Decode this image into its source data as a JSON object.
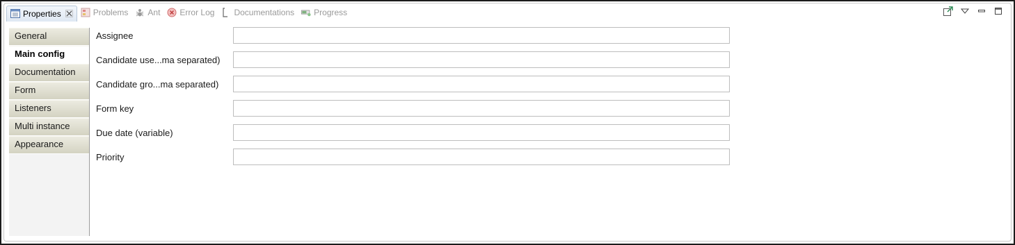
{
  "tabs": [
    {
      "label": "Properties",
      "icon": "properties-icon",
      "active": true
    },
    {
      "label": "Problems",
      "icon": "problems-icon"
    },
    {
      "label": "Ant",
      "icon": "ant-icon"
    },
    {
      "label": "Error Log",
      "icon": "error-log-icon"
    },
    {
      "label": "Documentations",
      "icon": "documentations-icon"
    },
    {
      "label": "Progress",
      "icon": "progress-icon"
    }
  ],
  "sidebar": {
    "items": [
      {
        "label": "General"
      },
      {
        "label": "Main config",
        "selected": true
      },
      {
        "label": "Documentation"
      },
      {
        "label": "Form"
      },
      {
        "label": "Listeners"
      },
      {
        "label": "Multi instance"
      },
      {
        "label": "Appearance"
      }
    ]
  },
  "form": {
    "rows": [
      {
        "label": "Assignee",
        "value": ""
      },
      {
        "label": "Candidate use...ma separated)",
        "value": ""
      },
      {
        "label": "Candidate gro...ma separated)",
        "value": ""
      },
      {
        "label": "Form key",
        "value": ""
      },
      {
        "label": "Due date (variable)",
        "value": ""
      },
      {
        "label": "Priority",
        "value": ""
      }
    ]
  },
  "colors": {
    "tab_active_bg": "#dfe8f3",
    "sidebar_item_bg": "#d4d3c2",
    "frame_border": "#1c1c1c"
  }
}
